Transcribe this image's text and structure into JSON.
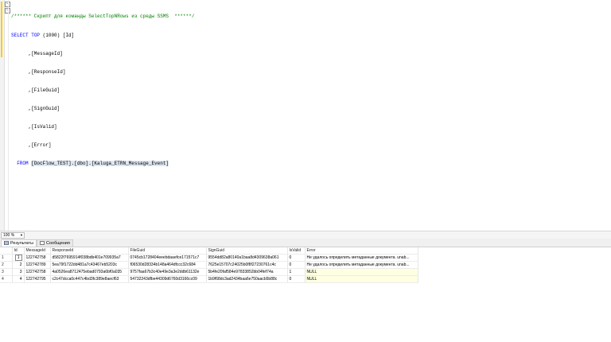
{
  "editor": {
    "comment": "/****** Скрипт для команды SelectTopNRows из среды SSMS  ******/",
    "select_kw": "SELECT",
    "top_kw": "TOP",
    "top_value": "(1000)",
    "first_column": "[Id]",
    "columns": [
      ",[MessageId]",
      ",[ResponseId]",
      ",[FileGuid]",
      ",[SignGuid]",
      ",[IsValid]",
      ",[Error]"
    ],
    "from_kw": "FROM",
    "table_ref": "[DocFlow_TEST].[dbo].[Kaluga_ETRN_Message_Event]",
    "fold_symbol": "−"
  },
  "zoom": {
    "value": "100 %",
    "dropdown_icon": "chevron-down-icon"
  },
  "tabs": [
    {
      "label": "Результаты",
      "icon": "grid-icon",
      "active": true
    },
    {
      "label": "Сообщения",
      "icon": "messages-icon",
      "active": false
    }
  ],
  "results": {
    "columns": [
      "Id",
      "MessageId",
      "ResponseId",
      "FileGuid",
      "SignGuid",
      "IsValid",
      "Error"
    ],
    "rows": [
      {
        "row_number": "1",
        "id": "1",
        "message_id": "122742758",
        "response_id": "d5822f7695914f038bdb401e709935a7",
        "file_guid": "0745cb1728404eeebdaaefce171571c7",
        "sign_guid": "9554dd82a80140a1baa8d4309638a061",
        "is_valid": "0",
        "error": "Не удалось определить метаданные документа. unab..."
      },
      {
        "row_number": "2",
        "id": "2",
        "message_id": "122742789",
        "response_id": "5ea79f1722dd481a7c43467eb5203c",
        "file_guid": "f06530d28334b148a464dfccc32c684",
        "sign_guid": "7625e15707c24025b0f8f27230761c4c",
        "is_valid": "0",
        "error": "Не удалось определить метаданные документа. unab..."
      },
      {
        "row_number": "3",
        "id": "3",
        "message_id": "122742758",
        "response_id": "4a0526ea8712475ebad0793a6bf0a035",
        "file_guid": "9757faa67b3c40e49e3a3e2ddb61132e",
        "sign_guid": "5b4fe20faf584e97833852bb04fef74a",
        "is_valid": "1",
        "error": "NULL"
      },
      {
        "row_number": "4",
        "id": "4",
        "message_id": "122742795",
        "response_id": "c2c47dcca0c447c4bd3fc389e8aecf63",
        "file_guid": "54732243dfbe44309d6760d3166cc09",
        "sign_guid": "1b9f68dc3ad2434baa6e750aacb5b88c",
        "is_valid": "0",
        "error": "NULL"
      }
    ]
  }
}
